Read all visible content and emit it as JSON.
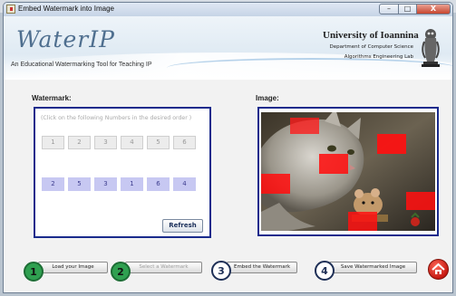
{
  "window": {
    "title": "Embed Watermark into Image"
  },
  "header": {
    "logo": "WaterIP",
    "tagline": "An Educational Watermarking Tool for Teaching IP",
    "university": "University of Ioannina",
    "department": "Department of Computer Science",
    "lab": "Algorithms Engineering Lab"
  },
  "watermark": {
    "label": "Watermark:",
    "hint": "(Click on the following Numbers in the desired order )",
    "numbers": [
      "1",
      "2",
      "3",
      "4",
      "5",
      "6"
    ],
    "order": [
      "2",
      "5",
      "3",
      "1",
      "6",
      "4"
    ],
    "refresh": "Refresh"
  },
  "image": {
    "label": "Image:"
  },
  "steps": [
    {
      "num": "1",
      "label": "Load your Image",
      "enabled": true
    },
    {
      "num": "2",
      "label": "Select a Watermark",
      "enabled": false
    },
    {
      "num": "3",
      "label": "Embed the Watermark",
      "enabled": true
    },
    {
      "num": "4",
      "label": "Save Watermarked Image",
      "enabled": true
    }
  ],
  "colors": {
    "accent": "#1a2b8c",
    "step_done": "#2fa050",
    "home": "#c51912",
    "watermark_block": "#ff1a1a"
  },
  "icons": {
    "home": "home-icon",
    "crest": "owl-crest-icon"
  }
}
